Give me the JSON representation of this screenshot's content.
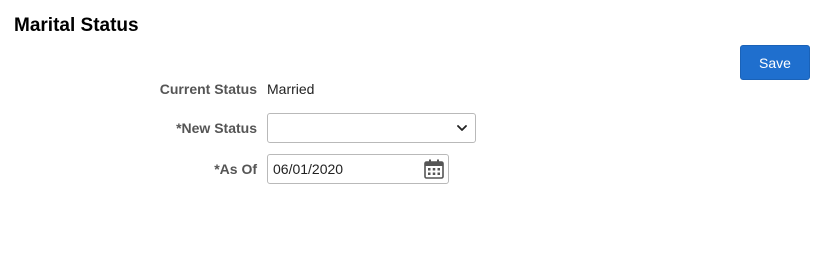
{
  "header": {
    "title": "Marital Status"
  },
  "toolbar": {
    "save_label": "Save"
  },
  "form": {
    "current_status": {
      "label": "Current Status",
      "value": "Married"
    },
    "new_status": {
      "label": "*New Status",
      "selected": ""
    },
    "as_of": {
      "label": "*As Of",
      "value": "06/01/2020"
    }
  },
  "colors": {
    "accent": "#1f6fce",
    "label_text": "#555555",
    "border": "#b9b9b9"
  },
  "icons": {
    "dropdown": "chevron-down-icon",
    "date_picker": "calendar-icon"
  }
}
